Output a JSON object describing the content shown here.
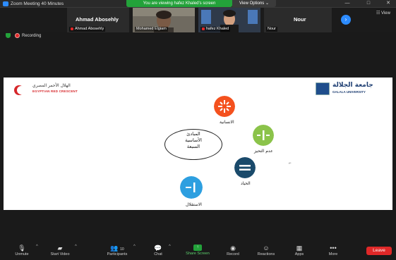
{
  "window": {
    "title": "Zoom Meeting 40 Minutes",
    "share_banner": "You are viewing hafez Khaled's screen",
    "view_options": "View Options ⌄",
    "controls": [
      "—",
      "□",
      "✕"
    ]
  },
  "video_strip": {
    "tiles": [
      {
        "big_name": "Ahmad Abosehly",
        "label": "Ahmad Abosehly"
      },
      {
        "label": "Mohamed Elgiam"
      },
      {
        "label": "hafez Khaled"
      },
      {
        "big_name": "Nour",
        "label": "Nour"
      }
    ],
    "view_label": "☷ View"
  },
  "status": {
    "recording_label": "Recording"
  },
  "slide": {
    "left_logo_arabic": "الهلال الأحمر المصري",
    "left_logo_english": "EGYPTIAN RED CRESCENT",
    "right_logo_arabic": "جامعة الجلالة",
    "right_logo_english": "GALALA UNIVERSITY",
    "center_lines": [
      "المبادئ",
      "الأساسية",
      "السبعة"
    ],
    "principles": [
      {
        "label": "الانسانية",
        "color": "#f4511e",
        "symbol": "✳"
      },
      {
        "label": "عدم التحيز",
        "color": "#8bc34a",
        "symbol": "ı—ı"
      },
      {
        "label": "الحياد",
        "color": "#1a4a6b",
        "symbol": "="
      },
      {
        "label": "الاستقلال",
        "color": "#2d9fe0",
        "symbol": "—ı"
      }
    ],
    "colors": {
      "red_crescent": "#d6262a",
      "university_blue": "#1f3f73"
    }
  },
  "toolbar": {
    "items": [
      {
        "icon": "microphone-muted-icon",
        "glyph": "🎙",
        "label": "Unmute"
      },
      {
        "icon": "video-off-icon",
        "glyph": "▰",
        "label": "Start Video"
      },
      {
        "icon": "participants-icon",
        "glyph": "👥",
        "label": "Participants",
        "badge": "10"
      },
      {
        "icon": "chat-icon",
        "glyph": "💬",
        "label": "Chat"
      },
      {
        "icon": "share-screen-icon",
        "glyph": "↑",
        "label": "Share Screen"
      },
      {
        "icon": "record-icon",
        "glyph": "◉",
        "label": "Record"
      },
      {
        "icon": "reactions-icon",
        "glyph": "☺",
        "label": "Reactions"
      },
      {
        "icon": "apps-icon",
        "glyph": "▦",
        "label": "Apps"
      },
      {
        "icon": "more-icon",
        "glyph": "•••",
        "label": "More"
      }
    ],
    "leave_label": "Leave",
    "colors": {
      "share_green": "#23a23a",
      "leave_red": "#e02828"
    }
  }
}
